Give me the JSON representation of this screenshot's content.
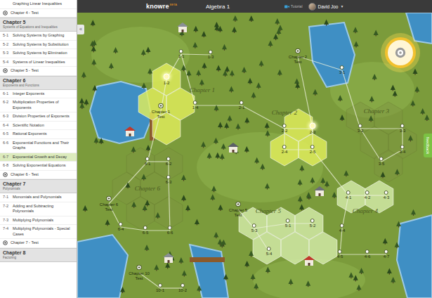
{
  "header": {
    "logo": "knowre",
    "badge": "BETA",
    "title": "Algebra 1",
    "tutorial": "Tutorial",
    "user": "David Joo",
    "caret": "▼"
  },
  "sidebar": {
    "collapse": "«",
    "rows": [
      {
        "kind": "item",
        "title": "Graphing Linear Inequalities",
        "selected": false
      },
      {
        "kind": "test",
        "title": "Chapter 4 - Test",
        "selected": false
      },
      {
        "kind": "chapter",
        "title": "Chapter 5",
        "subtitle": "Systems of Equations and Inequalities"
      },
      {
        "kind": "item",
        "code": "5-1",
        "title": "Solving Systems by Graphing",
        "selected": false
      },
      {
        "kind": "item",
        "code": "5-2",
        "title": "Solving Systems by Substitution",
        "selected": false
      },
      {
        "kind": "item",
        "code": "5-3",
        "title": "Solving Systems by Elimination",
        "selected": false
      },
      {
        "kind": "item",
        "code": "5-4",
        "title": "Systems of Linear Inequalities",
        "selected": false
      },
      {
        "kind": "test",
        "title": "Chapter 5 - Test",
        "selected": false
      },
      {
        "kind": "chapter",
        "title": "Chapter 6",
        "subtitle": "Exponents and Functions"
      },
      {
        "kind": "item",
        "code": "6-1",
        "title": "Integer Exponents",
        "selected": false
      },
      {
        "kind": "item",
        "code": "6-2",
        "title": "Multiplication Properties of Exponents",
        "selected": false
      },
      {
        "kind": "item",
        "code": "6-3",
        "title": "Division Properties of Exponents",
        "selected": false
      },
      {
        "kind": "item",
        "code": "6-4",
        "title": "Scientific Notation",
        "selected": false
      },
      {
        "kind": "item",
        "code": "6-5",
        "title": "Rational Exponents",
        "selected": false
      },
      {
        "kind": "item",
        "code": "6-6",
        "title": "Exponential Functions and Their Graphs",
        "selected": false
      },
      {
        "kind": "item",
        "code": "6-7",
        "title": "Exponential Growth and Decay",
        "selected": true
      },
      {
        "kind": "item",
        "code": "6-8",
        "title": "Solving Exponential Equations",
        "selected": false
      },
      {
        "kind": "test",
        "title": "Chapter 6 - Test",
        "selected": false
      },
      {
        "kind": "chapter",
        "title": "Chapter 7",
        "subtitle": "Polynomials"
      },
      {
        "kind": "item",
        "code": "7-1",
        "title": "Monomials and Polynomials",
        "selected": false
      },
      {
        "kind": "item",
        "code": "7-2",
        "title": "Adding and Subtracting Polynomials",
        "selected": false
      },
      {
        "kind": "item",
        "code": "7-3",
        "title": "Multiplying Polynomials",
        "selected": false
      },
      {
        "kind": "item",
        "code": "7-4",
        "title": "Multiplying Polynomials - Special Cases",
        "selected": false
      },
      {
        "kind": "test",
        "title": "Chapter 7 - Test",
        "selected": false
      },
      {
        "kind": "chapter",
        "title": "Chapter 8",
        "subtitle": "Factoring"
      }
    ]
  },
  "map": {
    "feedback": "feedback",
    "chapters": [
      {
        "label": "Chapter 1",
        "highlighted": true,
        "color": "#e2ee5c"
      },
      {
        "label": "Chapter 2",
        "highlighted": true,
        "color": "#e2ee5c"
      },
      {
        "label": "Chapter 3",
        "highlighted": false,
        "color": "#7f9440"
      },
      {
        "label": "Chapter 4",
        "highlighted": true,
        "color": "#d4ecaa"
      },
      {
        "label": "Chapter 5",
        "highlighted": true,
        "color": "#d4ecaa"
      },
      {
        "label": "Chapter 6",
        "highlighted": false,
        "color": "#7f9440"
      }
    ],
    "nodes": [
      {
        "label": "1-1",
        "kind": "lesson",
        "highlighted": false
      },
      {
        "label": "1-2",
        "kind": "lesson",
        "highlighted": true
      },
      {
        "label": "1-3",
        "kind": "lesson",
        "highlighted": false
      },
      {
        "label": "1-4",
        "kind": "lesson",
        "highlighted": false
      },
      {
        "label": "Chapter 1 Test",
        "kind": "test",
        "highlighted": false
      },
      {
        "label": "Chapter 2 Test",
        "kind": "test",
        "highlighted": false
      },
      {
        "label": "2-1",
        "kind": "lesson",
        "highlighted": false
      },
      {
        "label": "2-2",
        "kind": "lesson",
        "highlighted": false
      },
      {
        "label": "2-3",
        "kind": "lesson",
        "highlighted": true
      },
      {
        "label": "2-4",
        "kind": "lesson",
        "highlighted": false
      },
      {
        "label": "2-5",
        "kind": "lesson",
        "highlighted": false
      },
      {
        "label": "3-1",
        "kind": "lesson",
        "highlighted": false
      },
      {
        "label": "3-2",
        "kind": "lesson",
        "highlighted": false
      },
      {
        "label": "3-3",
        "kind": "lesson",
        "highlighted": false
      },
      {
        "label": "3-4",
        "kind": "lesson",
        "highlighted": false
      },
      {
        "label": "3-5",
        "kind": "lesson",
        "highlighted": false
      },
      {
        "label": "6-1",
        "kind": "lesson",
        "highlighted": false
      },
      {
        "label": "6-2",
        "kind": "lesson",
        "highlighted": false
      },
      {
        "label": "6-3",
        "kind": "lesson",
        "highlighted": false
      },
      {
        "label": "6-4",
        "kind": "lesson",
        "highlighted": false
      },
      {
        "label": "6-5",
        "kind": "lesson",
        "highlighted": false
      },
      {
        "label": "6-6",
        "kind": "lesson",
        "highlighted": false
      },
      {
        "label": "Chapter 6 Test",
        "kind": "test",
        "highlighted": false
      },
      {
        "label": "Chapter 5 Test",
        "kind": "test",
        "highlighted": false
      },
      {
        "label": "5-1",
        "kind": "lesson",
        "highlighted": false
      },
      {
        "label": "5-2",
        "kind": "lesson",
        "highlighted": false
      },
      {
        "label": "5-3",
        "kind": "lesson",
        "highlighted": false
      },
      {
        "label": "5-4",
        "kind": "lesson",
        "highlighted": false
      },
      {
        "label": "4-1",
        "kind": "lesson",
        "highlighted": false
      },
      {
        "label": "4-2",
        "kind": "lesson",
        "highlighted": false
      },
      {
        "label": "4-3",
        "kind": "lesson",
        "highlighted": false
      },
      {
        "label": "4-4",
        "kind": "lesson",
        "highlighted": false
      },
      {
        "label": "4-5",
        "kind": "lesson",
        "highlighted": false
      },
      {
        "label": "4-6",
        "kind": "lesson",
        "highlighted": false
      },
      {
        "label": "4-7",
        "kind": "lesson",
        "highlighted": false
      },
      {
        "label": "Chapter 10 Test",
        "kind": "test",
        "highlighted": false
      },
      {
        "label": "10-1",
        "kind": "lesson",
        "highlighted": false
      },
      {
        "label": "10-2",
        "kind": "lesson",
        "highlighted": false
      }
    ]
  }
}
